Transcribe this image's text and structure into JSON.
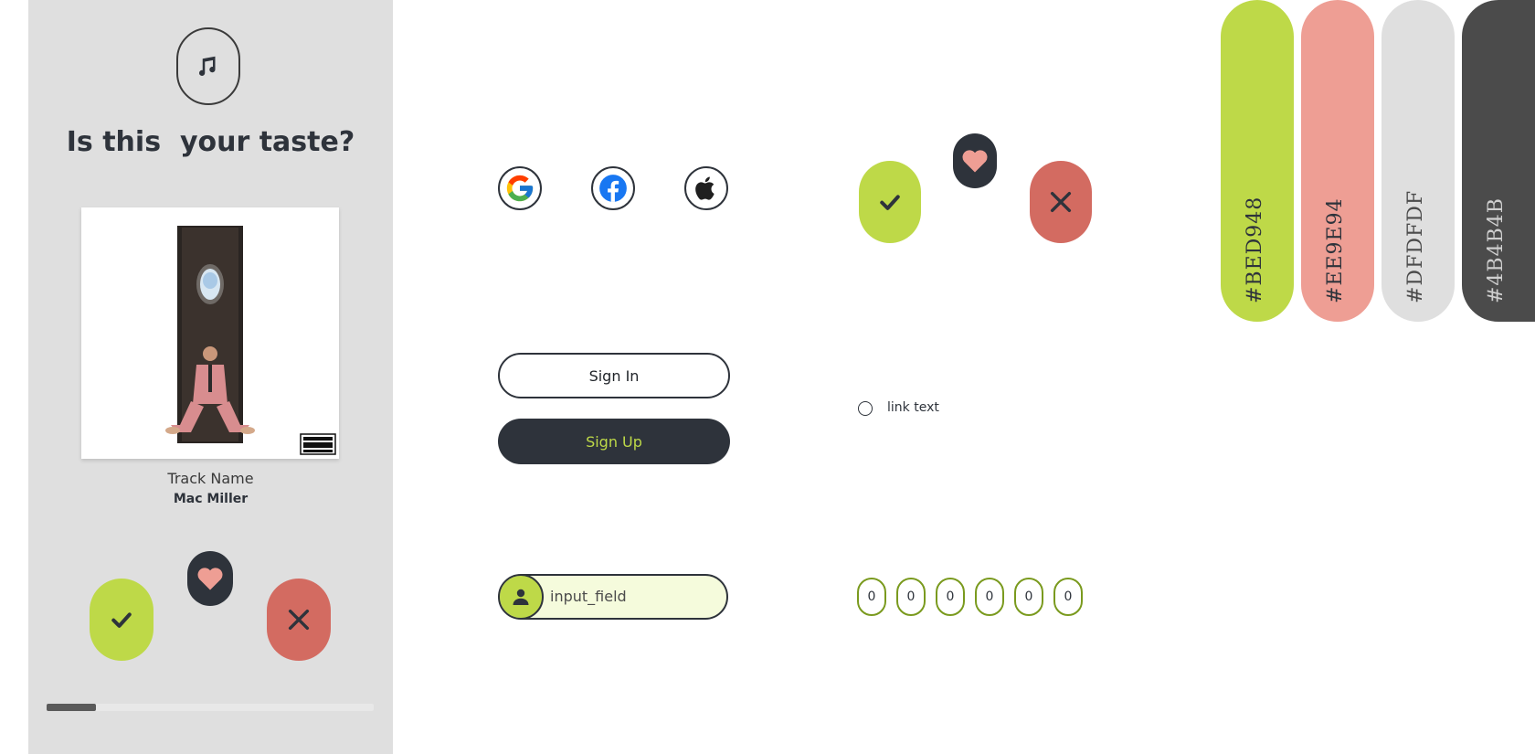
{
  "phone": {
    "title": "Is this  your taste?",
    "track_name": "Track Name",
    "artist": "Mac Miller",
    "album_art": "album-cover",
    "progress_percent": 15
  },
  "icons": {
    "music": "music-note-icon",
    "check": "check-icon",
    "heart": "heart-icon",
    "close": "close-icon",
    "user": "user-icon"
  },
  "social": {
    "google": "google-icon",
    "facebook": "facebook-icon",
    "apple": "apple-icon"
  },
  "buttons": {
    "sign_in": "Sign In",
    "sign_up": "Sign Up"
  },
  "radio": {
    "label": "link text"
  },
  "input": {
    "value": "input_field"
  },
  "otp": [
    "0",
    "0",
    "0",
    "0",
    "0",
    "0"
  ],
  "palette": [
    {
      "hex": "#BED948",
      "color": "#bed948",
      "text_color": "#2e333b"
    },
    {
      "hex": "#EE9E94",
      "color": "#ee9e94",
      "text_color": "#2e333b"
    },
    {
      "hex": "#DFDFDF",
      "color": "#dfdfdf",
      "text_color": "#4b4b4b"
    },
    {
      "hex": "#4B4B4B",
      "color": "#4b4b4b",
      "text_color": "#cfcfcf"
    }
  ],
  "colors": {
    "accent": "#bed948",
    "pink": "#ee9e94",
    "danger": "#d36b61",
    "dark": "#2e333b",
    "light_gray": "#dfdfdf"
  }
}
